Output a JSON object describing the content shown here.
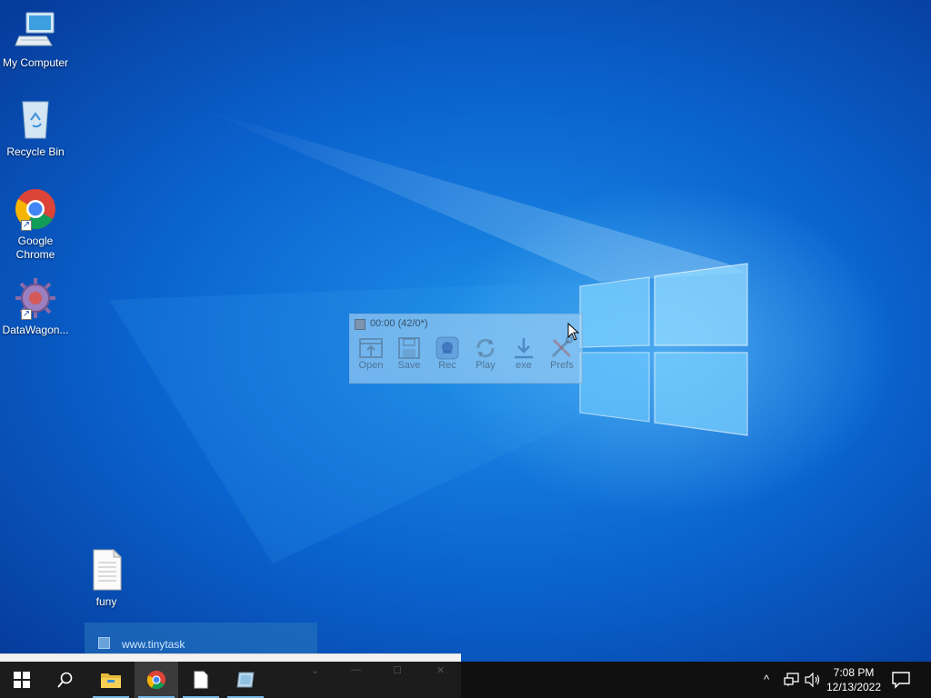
{
  "desktop": {
    "icons": [
      {
        "label": "My Computer"
      },
      {
        "label": "Recycle Bin"
      },
      {
        "label": "Google Chrome"
      },
      {
        "label": "DataWagon..."
      },
      {
        "label": "funy"
      }
    ]
  },
  "tinytask": {
    "title": "00:00 (42/0*)",
    "buttons": [
      {
        "label": "Open",
        "icon": "open-icon"
      },
      {
        "label": "Save",
        "icon": "save-icon"
      },
      {
        "label": "Rec",
        "icon": "record-icon"
      },
      {
        "label": "Play",
        "icon": "play-icon"
      },
      {
        "label": "exe",
        "icon": "compile-exe-icon"
      },
      {
        "label": "Prefs",
        "icon": "prefs-icon"
      }
    ]
  },
  "taskbar_preview": {
    "text": "www.tinytask"
  },
  "taskbar": {
    "apps": [
      "start-button",
      "search-button",
      "file-explorer",
      "google-chrome",
      "notepad-file",
      "tinytask"
    ],
    "active_app": "google-chrome"
  },
  "tray": {
    "time": "7:08 PM",
    "date": "12/13/2022"
  },
  "colors": {
    "taskbar": "#101010",
    "accent": "#76b9ed",
    "wallpaper": "#0a63cf"
  }
}
